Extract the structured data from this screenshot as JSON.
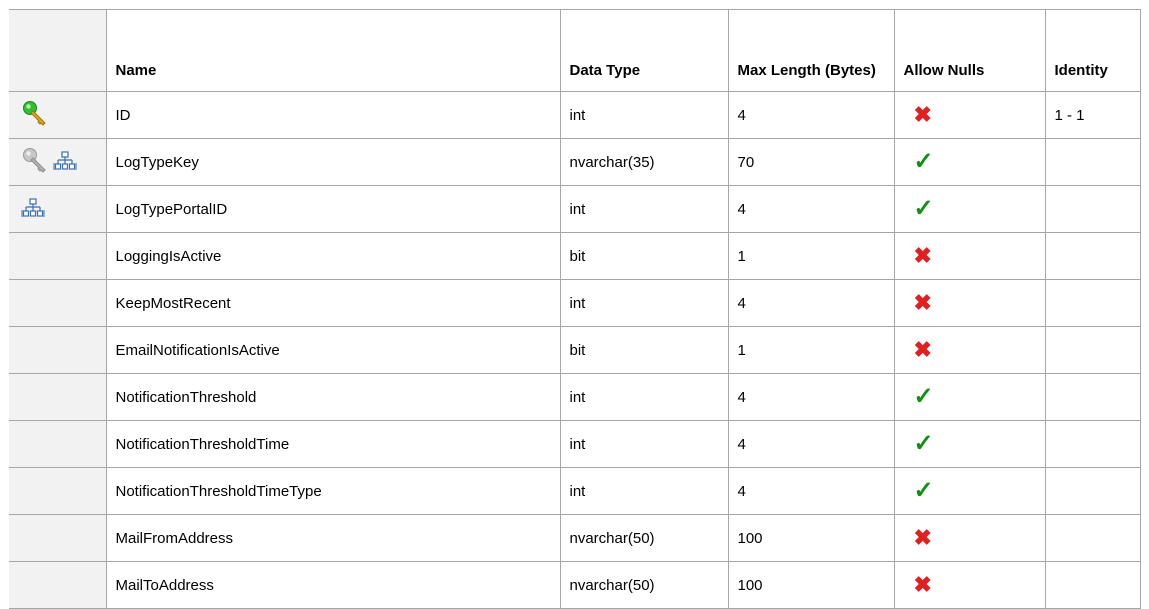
{
  "columns": [
    "",
    "Name",
    "Data Type",
    "Max Length (Bytes)",
    "Allow Nulls",
    "Identity"
  ],
  "colors": {
    "check": "#109010",
    "cross": "#e02020",
    "icon_cell_bg": "#f2f2f2"
  },
  "rows": [
    {
      "icons": [
        "primary-key-icon"
      ],
      "name": "ID",
      "type": "int",
      "length": "4",
      "allow_nulls": "no",
      "identity": "1 - 1"
    },
    {
      "icons": [
        "key-icon",
        "relationship-icon"
      ],
      "name": "LogTypeKey",
      "type": "nvarchar(35)",
      "length": "70",
      "allow_nulls": "yes",
      "identity": ""
    },
    {
      "icons": [
        "relationship-icon"
      ],
      "name": "LogTypePortalID",
      "type": "int",
      "length": "4",
      "allow_nulls": "yes",
      "identity": ""
    },
    {
      "icons": [],
      "name": "LoggingIsActive",
      "type": "bit",
      "length": "1",
      "allow_nulls": "no",
      "identity": ""
    },
    {
      "icons": [],
      "name": "KeepMostRecent",
      "type": "int",
      "length": "4",
      "allow_nulls": "no",
      "identity": ""
    },
    {
      "icons": [],
      "name": "EmailNotificationIsActive",
      "type": "bit",
      "length": "1",
      "allow_nulls": "no",
      "identity": ""
    },
    {
      "icons": [],
      "name": "NotificationThreshold",
      "type": "int",
      "length": "4",
      "allow_nulls": "yes",
      "identity": ""
    },
    {
      "icons": [],
      "name": "NotificationThresholdTime",
      "type": "int",
      "length": "4",
      "allow_nulls": "yes",
      "identity": ""
    },
    {
      "icons": [],
      "name": "NotificationThresholdTimeType",
      "type": "int",
      "length": "4",
      "allow_nulls": "yes",
      "identity": ""
    },
    {
      "icons": [],
      "name": "MailFromAddress",
      "type": "nvarchar(50)",
      "length": "100",
      "allow_nulls": "no",
      "identity": ""
    },
    {
      "icons": [],
      "name": "MailToAddress",
      "type": "nvarchar(50)",
      "length": "100",
      "allow_nulls": "no",
      "identity": ""
    }
  ]
}
